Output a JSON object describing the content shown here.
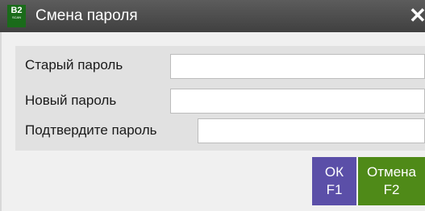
{
  "window": {
    "title": "Смена пароля",
    "logo_text": "B2",
    "logo_sub": "SCAN",
    "close_glyph": "✕"
  },
  "form": {
    "old_password_label": "Старый пароль",
    "old_password_value": "",
    "new_password_label": "Новый пароль",
    "new_password_value": "",
    "confirm_password_label": "Подтвердите пароль",
    "confirm_password_value": ""
  },
  "buttons": {
    "ok_label": "ОК",
    "ok_key": "F1",
    "cancel_label": "Отмена",
    "cancel_key": "F2"
  },
  "colors": {
    "titlebar": "#4a4a4a",
    "ok_button": "#5b4fa8",
    "cancel_button": "#4f8a18",
    "logo": "#1a6b1a"
  }
}
